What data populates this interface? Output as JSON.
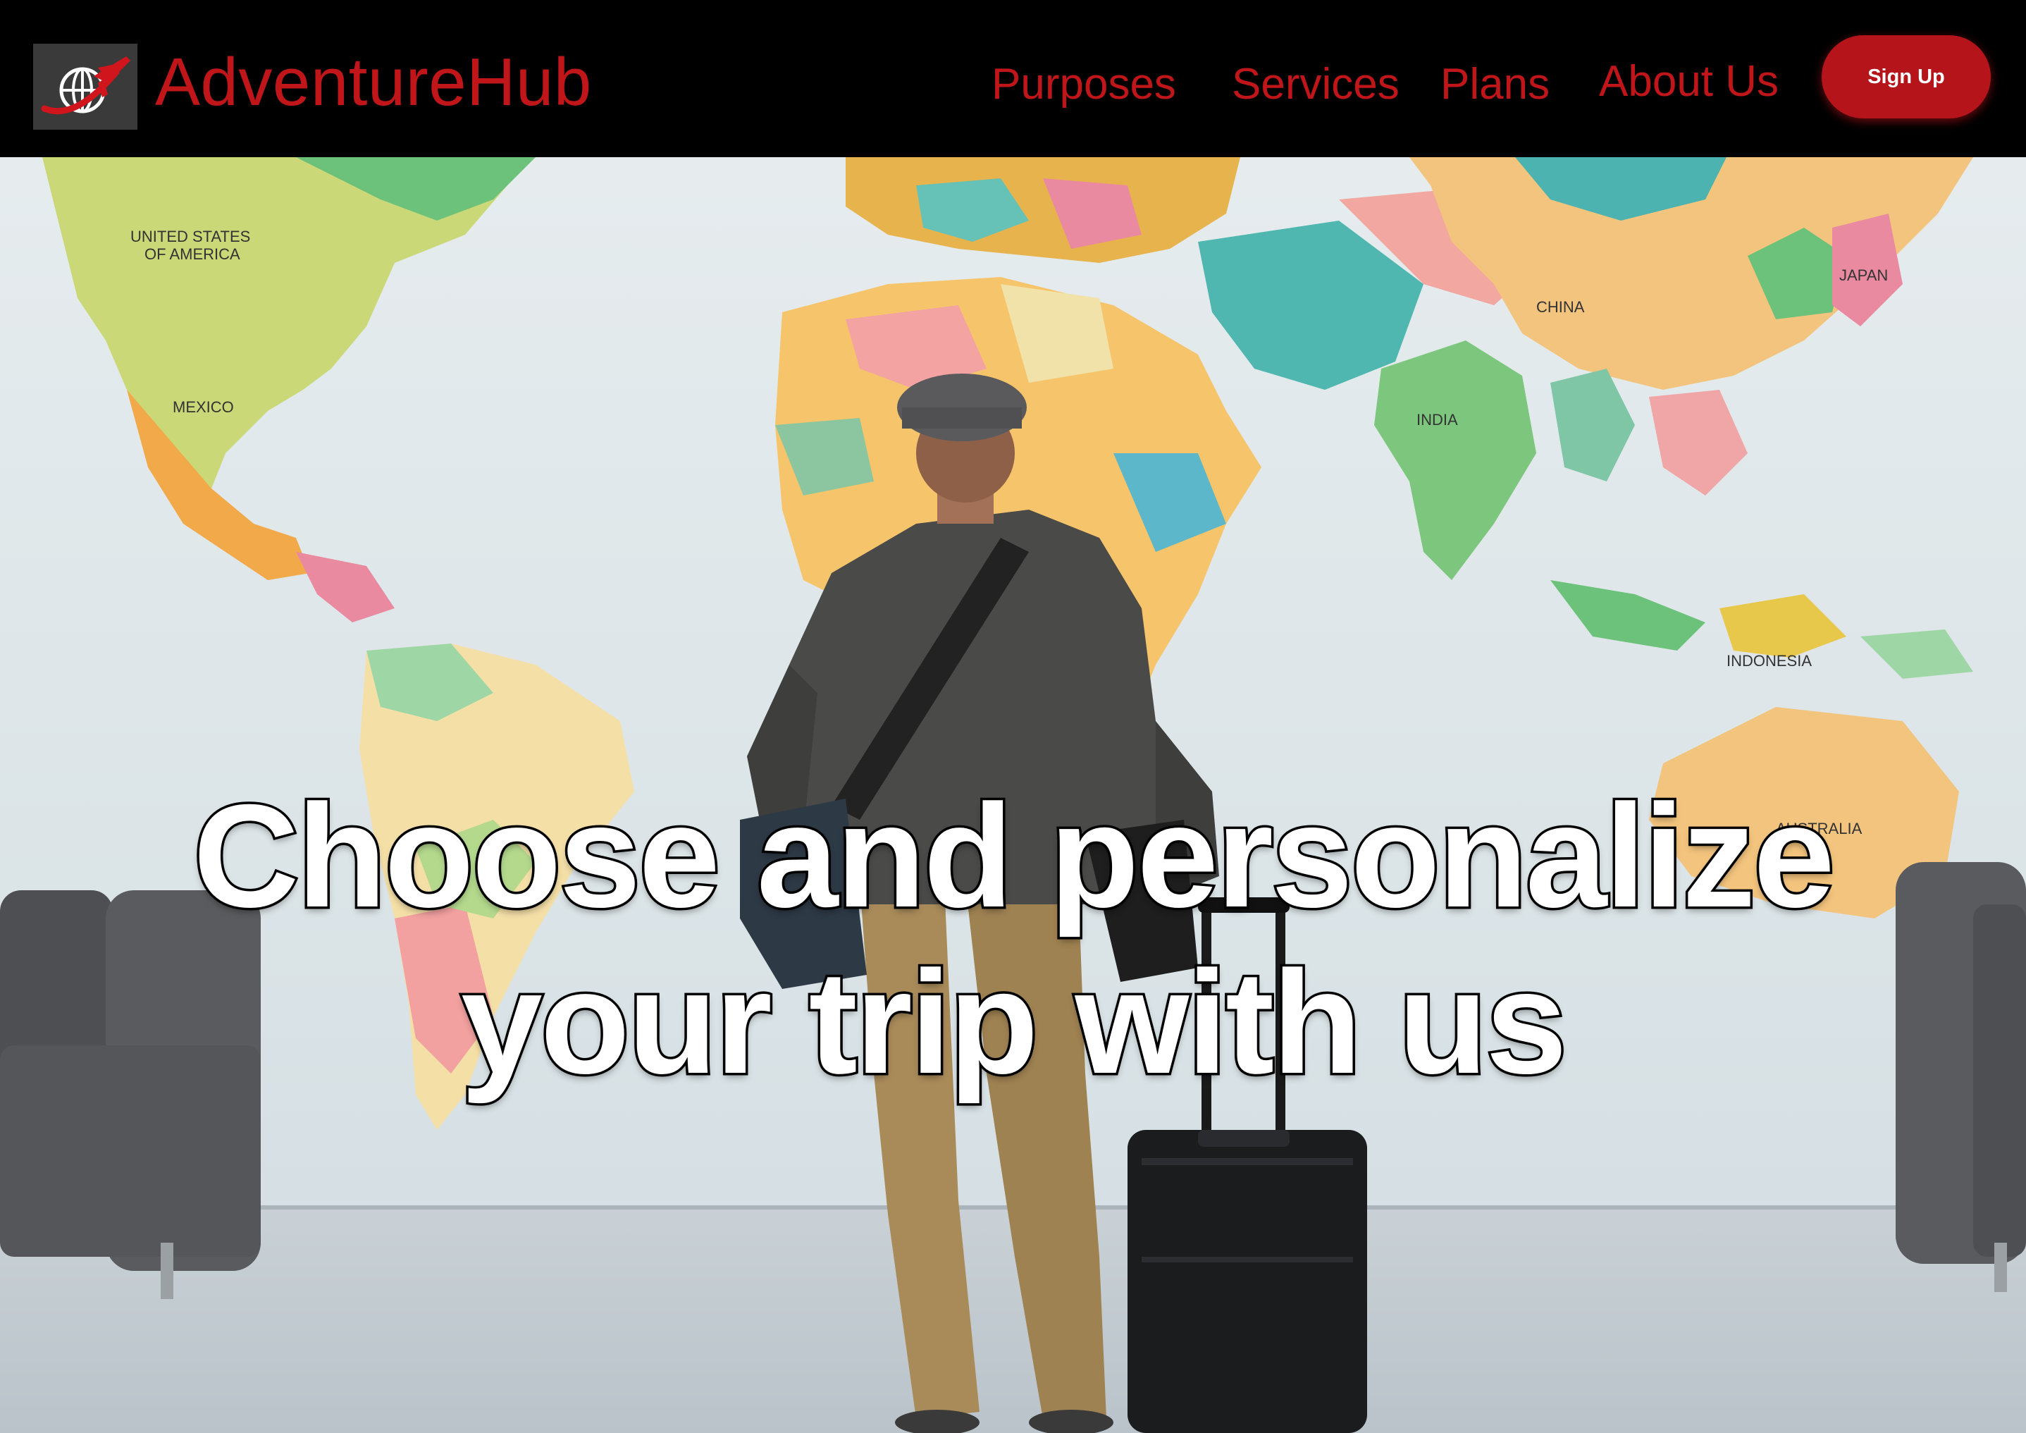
{
  "brand": {
    "name": "AdventureHub",
    "logo_icon": "globe-airplane-icon",
    "color": "#c0161a"
  },
  "nav": {
    "items": [
      {
        "label": "Purposes"
      },
      {
        "label": "Services"
      },
      {
        "label": "Plans"
      },
      {
        "label": "About Us"
      }
    ],
    "signup_label": "Sign Up",
    "signup_color": "#b4141a"
  },
  "hero": {
    "headline_line1": "Choose and personalize",
    "headline_line2": "your trip with us",
    "image_subject": "traveler-with-suitcase-facing-world-map",
    "map_labels": [
      "UNITED STATES OF AMERICA",
      "MEXICO",
      "CHINA",
      "JAPAN",
      "INDIA",
      "INDONESIA",
      "AUSTRALIA"
    ]
  }
}
